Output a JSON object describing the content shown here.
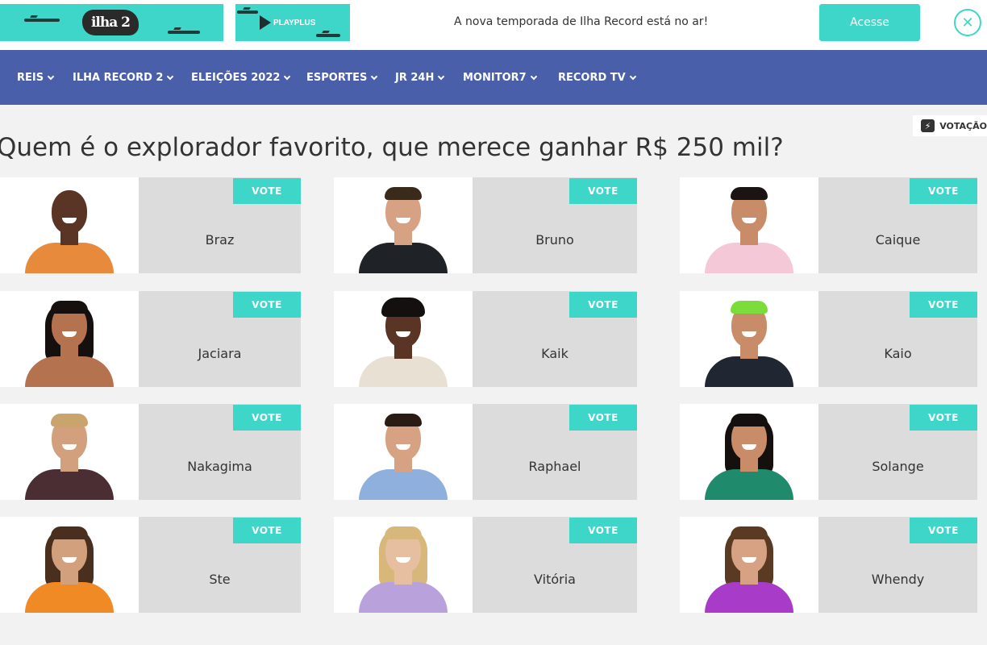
{
  "promo": {
    "banner_logo_text": "ilha 2",
    "banner2_text": "PLAYPLUS",
    "message": "A nova temporada de Ilha Record está no ar!",
    "cta_label": "Acesse",
    "close_symbol": "✕",
    "accent_color": "#3dd6c8"
  },
  "nav": {
    "background_color": "#4a5fa9",
    "items": [
      {
        "label": "REIS"
      },
      {
        "label": "ILHA RECORD 2"
      },
      {
        "label": "ELEIÇÕES 2022"
      },
      {
        "label": "ESPORTES"
      },
      {
        "label": "JR 24H"
      },
      {
        "label": "MONITOR7"
      },
      {
        "label": "RECORD TV"
      }
    ]
  },
  "poll": {
    "title": "Quem é o explorador favorito, que merece ganhar R$ 250 mil?",
    "tag_label": "VOTAÇÃO",
    "tag_icon": "bolt-icon",
    "vote_label": "VOTE",
    "candidates": [
      {
        "name": "Braz",
        "skin": "#5a3424",
        "hair": "#1c1410",
        "shirt": "#e78a3c",
        "hair_style": "bald"
      },
      {
        "name": "Bruno",
        "skin": "#d7a283",
        "hair": "#3a2a1c",
        "shirt": "#1f2226",
        "hair_style": "short"
      },
      {
        "name": "Caique",
        "skin": "#c98c68",
        "hair": "#1a1412",
        "shirt": "#f4c8d6",
        "hair_style": "short"
      },
      {
        "name": "Jaciara",
        "skin": "#b5724e",
        "hair": "#15100e",
        "shirt": "#b5724e",
        "hair_style": "long"
      },
      {
        "name": "Kaik",
        "skin": "#5a3424",
        "hair": "#141010",
        "shirt": "#e8e0d2",
        "hair_style": "curly"
      },
      {
        "name": "Kaio",
        "skin": "#c98c68",
        "hair": "#7cdc3c",
        "shirt": "#202632",
        "hair_style": "short"
      },
      {
        "name": "Nakagima",
        "skin": "#d2a07c",
        "hair": "#c9a46c",
        "shirt": "#4a2e34",
        "hair_style": "short"
      },
      {
        "name": "Raphael",
        "skin": "#d7a283",
        "hair": "#2a1c14",
        "shirt": "#8fb0dc",
        "hair_style": "short"
      },
      {
        "name": "Solange",
        "skin": "#c98c68",
        "hair": "#15100e",
        "shirt": "#1f8a6c",
        "hair_style": "long"
      },
      {
        "name": "Ste",
        "skin": "#d2a07c",
        "hair": "#4a2e1e",
        "shirt": "#f08a24",
        "hair_style": "long"
      },
      {
        "name": "Vitória",
        "skin": "#e6bea0",
        "hair": "#d8b87a",
        "shirt": "#b9a2dc",
        "hair_style": "long"
      },
      {
        "name": "Whendy",
        "skin": "#d7a283",
        "hair": "#5a3a22",
        "shirt": "#a83cc8",
        "hair_style": "long"
      }
    ]
  }
}
